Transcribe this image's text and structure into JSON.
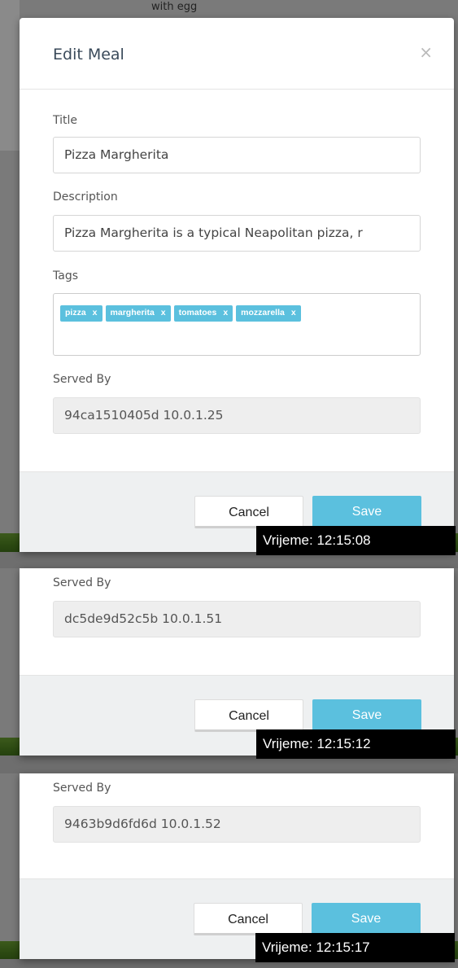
{
  "background": {
    "top_text": "with egg"
  },
  "modal": {
    "title": "Edit Meal",
    "close_glyph": "×",
    "title_label": "Title",
    "title_value": "Pizza Margherita",
    "description_label": "Description",
    "description_value": "Pizza Margherita is a typical Neapolitan pizza, r",
    "tags_label": "Tags",
    "tags": [
      "pizza",
      "margherita",
      "tomatoes",
      "mozzarella"
    ],
    "tag_remove_glyph": "x",
    "accent_color": "#5bc0de"
  },
  "panels": [
    {
      "served_by_label": "Served By",
      "served_by_value": "94ca1510405d 10.0.1.25",
      "cancel_label": "Cancel",
      "save_label": "Save",
      "timestamp": "Vrijeme: 12:15:08"
    },
    {
      "served_by_label": "Served By",
      "served_by_value": "dc5de9d52c5b 10.0.1.51",
      "cancel_label": "Cancel",
      "save_label": "Save",
      "timestamp": "Vrijeme: 12:15:12"
    },
    {
      "served_by_label": "Served By",
      "served_by_value": "9463b9d6fd6d 10.0.1.52",
      "cancel_label": "Cancel",
      "save_label": "Save",
      "timestamp": "Vrijeme: 12:15:17"
    }
  ]
}
